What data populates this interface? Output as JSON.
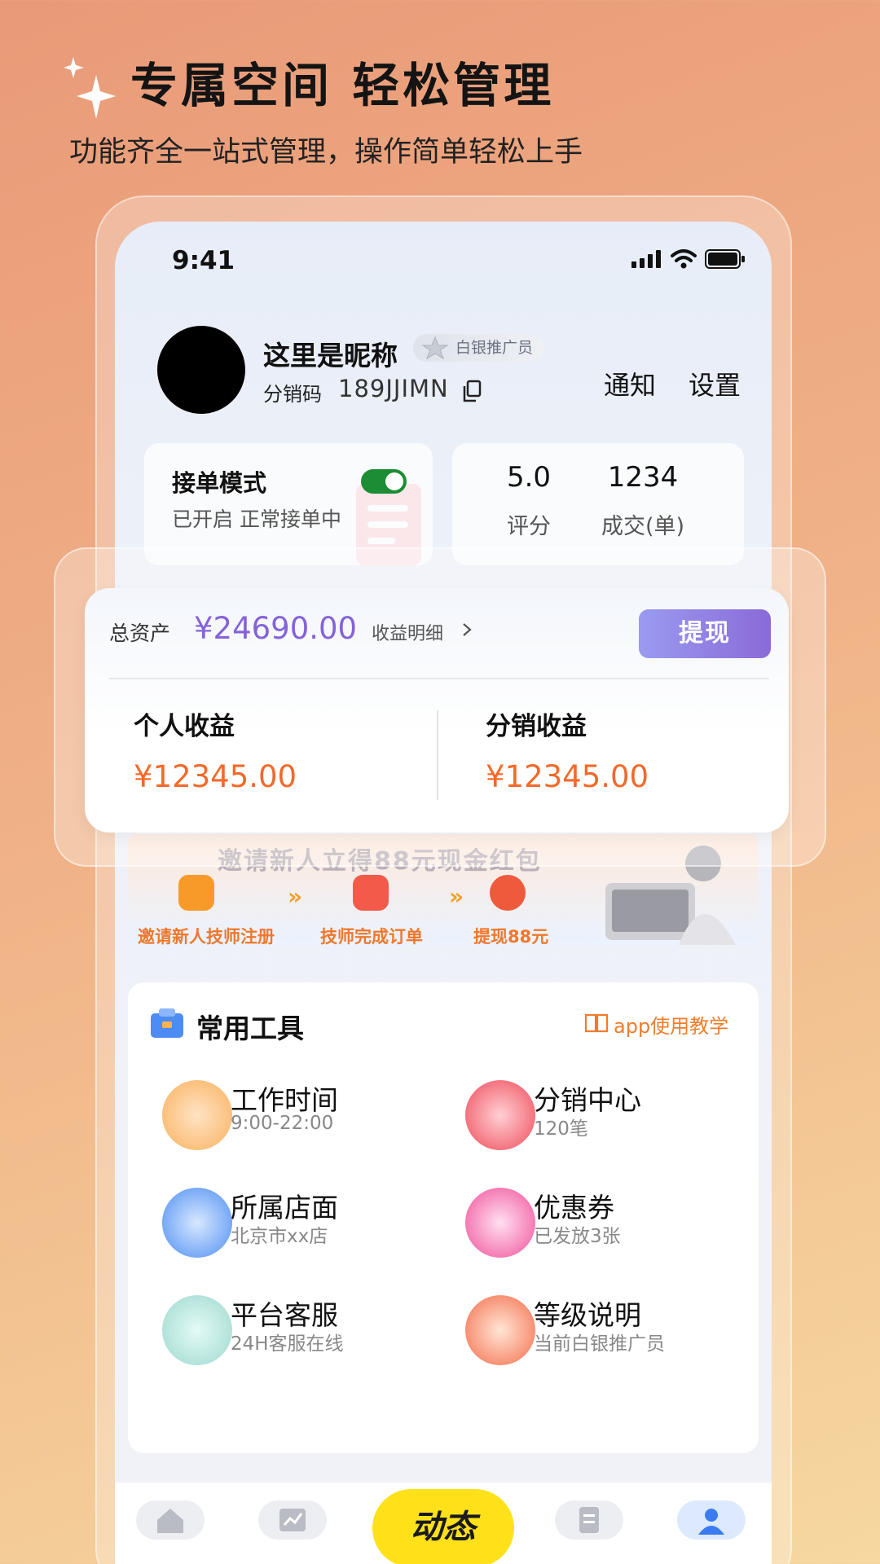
{
  "promo": {
    "title": "专属空间 轻松管理",
    "subtitle": "功能齐全一站式管理，操作简单轻松上手"
  },
  "status_bar": {
    "time": "9:41"
  },
  "profile": {
    "nickname": "这里是昵称",
    "rank_badge": "白银推广员",
    "code_label": "分销码",
    "code_value": "189JJIMN",
    "notify_label": "通知",
    "settings_label": "设置"
  },
  "order_mode": {
    "title": "接单模式",
    "status": "已开启 正常接单中",
    "enabled": true
  },
  "stats": [
    {
      "value": "5.0",
      "label": "评分"
    },
    {
      "value": "1234",
      "label": "成交(单)"
    }
  ],
  "assets": {
    "total_label": "总资产",
    "total_value": "¥24690.00",
    "detail_link": "收益明细",
    "withdraw_label": "提现",
    "personal_title": "个人收益",
    "personal_value": "¥12345.00",
    "distribution_title": "分销收益",
    "distribution_value": "¥12345.00"
  },
  "banner": {
    "headline": "邀请新人立得88元现金红包",
    "steps": [
      "邀请新人技师注册",
      "技师完成订单",
      "提现88元"
    ]
  },
  "tools": {
    "title": "常用工具",
    "tutorial_link": "app使用教学",
    "items": [
      {
        "name": "工作时间",
        "sub": "9:00-22:00",
        "icon": "alarm-clock-icon"
      },
      {
        "name": "分销中心",
        "sub": "120笔",
        "icon": "distribution-icon"
      },
      {
        "name": "所属店面",
        "sub": "北京市xx店",
        "icon": "storefront-icon"
      },
      {
        "name": "优惠券",
        "sub": "已发放3张",
        "icon": "gift-box-icon"
      },
      {
        "name": "平台客服",
        "sub": "24H客服在线",
        "icon": "customer-service-icon"
      },
      {
        "name": "等级说明",
        "sub": "当前白银推广员",
        "icon": "diamond-icon"
      }
    ]
  },
  "tabbar": {
    "center_label": "动态",
    "tabs": [
      "home-icon",
      "chart-icon",
      "orders-icon",
      "profile-icon"
    ]
  },
  "colors": {
    "accent_purple": "#8463d8",
    "earnings_orange": "#f26a2a",
    "toggle_green": "#1b8d34",
    "center_tab_yellow": "#ffe11a"
  }
}
